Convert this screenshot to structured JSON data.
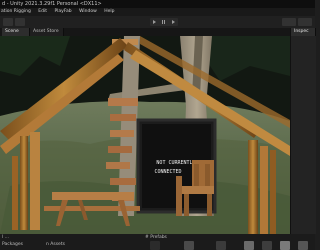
{
  "window": {
    "title": "d - Unity 2021.3.29f1 Personal <DX11>"
  },
  "menu": {
    "items": [
      "ation Rigging",
      "Edit",
      "PlayFab",
      "Window",
      "Help"
    ]
  },
  "tabs": [
    {
      "label": "Scene",
      "active": true
    },
    {
      "label": "Asset Store",
      "active": false
    }
  ],
  "right_tab": {
    "label": "Inspec"
  },
  "scene": {
    "sign_line1": "NOT CURRENTLY",
    "sign_line2": "CONNECTED"
  },
  "bottom": {
    "left_label": "l ...",
    "search_label": "Packages",
    "tab_label": "n Assets",
    "prefabs_label": "# Prefabs"
  },
  "colors": {
    "editor_bg": "#1e1e1e",
    "sky": "#121812",
    "wood": "#a4712c",
    "ground": "#5c6a4e"
  }
}
